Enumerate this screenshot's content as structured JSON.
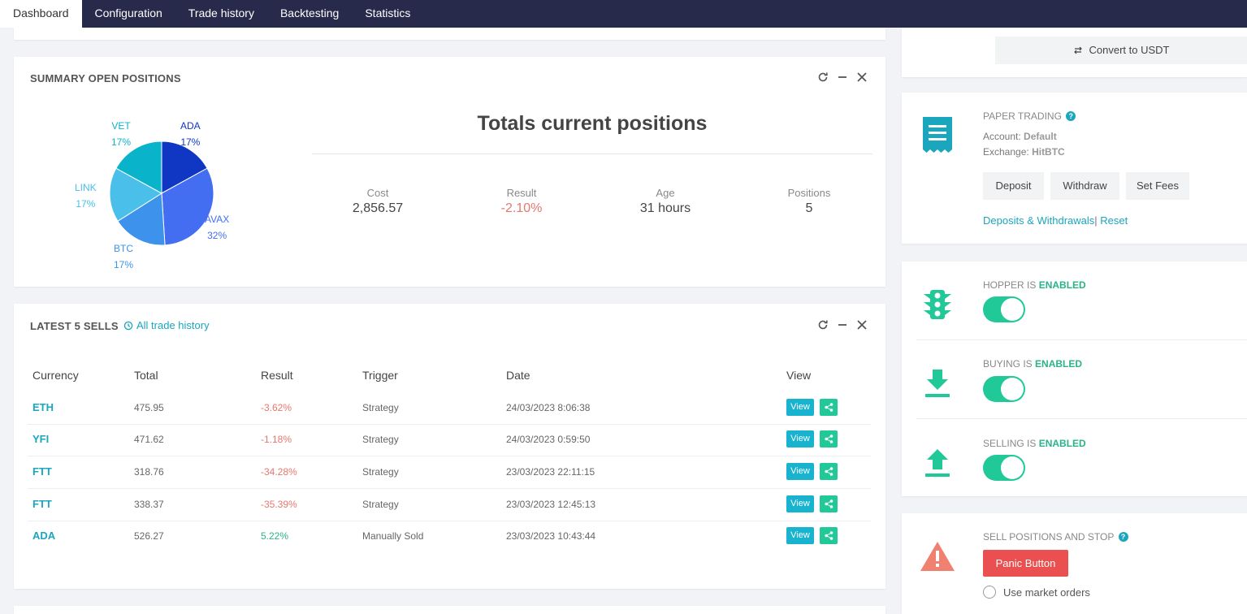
{
  "nav": {
    "tabs": [
      "Dashboard",
      "Configuration",
      "Trade history",
      "Backtesting",
      "Statistics"
    ],
    "active": "Dashboard"
  },
  "summary": {
    "title": "SUMMARY OPEN POSITIONS",
    "heading": "Totals current positions",
    "pie": [
      {
        "name": "ADA",
        "percent": 17,
        "label_pct": "17%",
        "color": "#0f37c4"
      },
      {
        "name": "AVAX",
        "percent": 32,
        "label_pct": "32%",
        "color": "#436ef2"
      },
      {
        "name": "BTC",
        "percent": 17,
        "label_pct": "17%",
        "color": "#3d93ec"
      },
      {
        "name": "LINK",
        "percent": 17,
        "label_pct": "17%",
        "color": "#49bfe9"
      },
      {
        "name": "VET",
        "percent": 17,
        "label_pct": "17%",
        "color": "#09b3c9"
      }
    ],
    "stats": [
      {
        "label": "Cost",
        "value": "2,856.57"
      },
      {
        "label": "Result",
        "value": "-2.10%"
      },
      {
        "label": "Age",
        "value": "31 hours"
      },
      {
        "label": "Positions",
        "value": "5"
      }
    ]
  },
  "sells": {
    "title": "LATEST 5 SELLS",
    "history_link": "All trade history",
    "columns": [
      "Currency",
      "Total",
      "Result",
      "Trigger",
      "Date",
      "View"
    ],
    "rows": [
      {
        "currency": "ETH",
        "total": "475.95",
        "result": "-3.62%",
        "trigger": "Strategy",
        "date": "24/03/2023 8:06:38"
      },
      {
        "currency": "YFI",
        "total": "471.62",
        "result": "-1.18%",
        "trigger": "Strategy",
        "date": "24/03/2023 0:59:50"
      },
      {
        "currency": "FTT",
        "total": "318.76",
        "result": "-34.28%",
        "trigger": "Strategy",
        "date": "23/03/2023 22:11:15"
      },
      {
        "currency": "FTT",
        "total": "338.37",
        "result": "-35.39%",
        "trigger": "Strategy",
        "date": "23/03/2023 12:45:13"
      },
      {
        "currency": "ADA",
        "total": "526.27",
        "result": "5.22%",
        "trigger": "Manually Sold",
        "date": "23/03/2023 10:43:44"
      }
    ],
    "view_label": "View"
  },
  "wallet": {
    "convert_label": "Convert to USDT"
  },
  "paper": {
    "title": "PAPER TRADING",
    "account_label": "Account:",
    "account_value": "Default",
    "exchange_label": "Exchange:",
    "exchange_value": "HitBTC",
    "deposit": "Deposit",
    "withdraw": "Withdraw",
    "set_fees": "Set Fees",
    "deposits_link": "Deposits & Withdrawals",
    "separator": "|",
    "reset_link": "Reset"
  },
  "toggles": [
    {
      "prefix": "HOPPER IS",
      "state": "ENABLED",
      "on": true
    },
    {
      "prefix": "BUYING IS",
      "state": "ENABLED",
      "on": true
    },
    {
      "prefix": "SELLING IS",
      "state": "ENABLED",
      "on": true
    }
  ],
  "panic": {
    "title": "SELL POSITIONS AND STOP",
    "button": "Panic Button",
    "market_orders": "Use market orders"
  },
  "colors": {
    "accent": "#1aa6bd",
    "green": "#20c997",
    "danger": "#e9504f",
    "nav_bg": "#272a4a"
  }
}
